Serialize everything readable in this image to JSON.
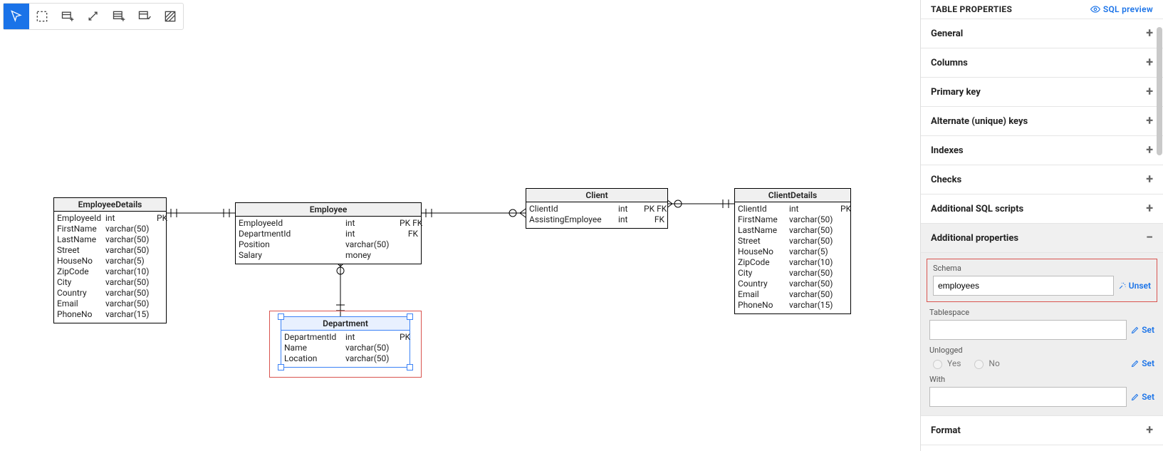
{
  "panel": {
    "title": "TABLE PROPERTIES",
    "sql_preview": "SQL preview",
    "sections": {
      "general": "General",
      "columns": "Columns",
      "primary_key": "Primary key",
      "alternate_keys": "Alternate (unique) keys",
      "indexes": "Indexes",
      "checks": "Checks",
      "additional_sql": "Additional SQL scripts",
      "additional_props": "Additional properties",
      "format": "Format"
    },
    "additional_props": {
      "schema_label": "Schema",
      "schema_value": "employees",
      "schema_action": "Unset",
      "tablespace_label": "Tablespace",
      "tablespace_value": "",
      "tablespace_action": "Set",
      "unlogged_label": "Unlogged",
      "unlogged_yes": "Yes",
      "unlogged_no": "No",
      "unlogged_action": "Set",
      "with_label": "With",
      "with_value": "",
      "with_action": "Set"
    }
  },
  "tables": {
    "employee_details": {
      "name": "EmployeeDetails",
      "rows": [
        {
          "col": "EmployeeId",
          "type": "int",
          "key": "PK"
        },
        {
          "col": "FirstName",
          "type": "varchar(50)",
          "key": ""
        },
        {
          "col": "LastName",
          "type": "varchar(50)",
          "key": ""
        },
        {
          "col": "Street",
          "type": "varchar(50)",
          "key": ""
        },
        {
          "col": "HouseNo",
          "type": "varchar(5)",
          "key": ""
        },
        {
          "col": "ZipCode",
          "type": "varchar(10)",
          "key": ""
        },
        {
          "col": "City",
          "type": "varchar(50)",
          "key": ""
        },
        {
          "col": "Country",
          "type": "varchar(50)",
          "key": ""
        },
        {
          "col": "Email",
          "type": "varchar(50)",
          "key": ""
        },
        {
          "col": "PhoneNo",
          "type": "varchar(15)",
          "key": ""
        }
      ]
    },
    "employee": {
      "name": "Employee",
      "rows": [
        {
          "col": "EmployeeId",
          "type": "int",
          "key": "PK FK"
        },
        {
          "col": "DepartmentId",
          "type": "int",
          "key": "FK"
        },
        {
          "col": "Position",
          "type": "varchar(50)",
          "key": ""
        },
        {
          "col": "Salary",
          "type": "money",
          "key": ""
        }
      ]
    },
    "client": {
      "name": "Client",
      "rows": [
        {
          "col": "ClientId",
          "type": "int",
          "key": "PK FK"
        },
        {
          "col": "AssistingEmployee",
          "type": "int",
          "key": "FK"
        }
      ]
    },
    "client_details": {
      "name": "ClientDetails",
      "rows": [
        {
          "col": "ClientId",
          "type": "int",
          "key": "PK"
        },
        {
          "col": "FirstName",
          "type": "varchar(50)",
          "key": ""
        },
        {
          "col": "LastName",
          "type": "varchar(50)",
          "key": ""
        },
        {
          "col": "Street",
          "type": "varchar(50)",
          "key": ""
        },
        {
          "col": "HouseNo",
          "type": "varchar(5)",
          "key": ""
        },
        {
          "col": "ZipCode",
          "type": "varchar(10)",
          "key": ""
        },
        {
          "col": "City",
          "type": "varchar(50)",
          "key": ""
        },
        {
          "col": "Country",
          "type": "varchar(50)",
          "key": ""
        },
        {
          "col": "Email",
          "type": "varchar(50)",
          "key": ""
        },
        {
          "col": "PhoneNo",
          "type": "varchar(15)",
          "key": ""
        }
      ]
    },
    "department": {
      "name": "Department",
      "rows": [
        {
          "col": "DepartmentId",
          "type": "int",
          "key": "PK"
        },
        {
          "col": "Name",
          "type": "varchar(50)",
          "key": ""
        },
        {
          "col": "Location",
          "type": "varchar(50)",
          "key": ""
        }
      ]
    }
  }
}
